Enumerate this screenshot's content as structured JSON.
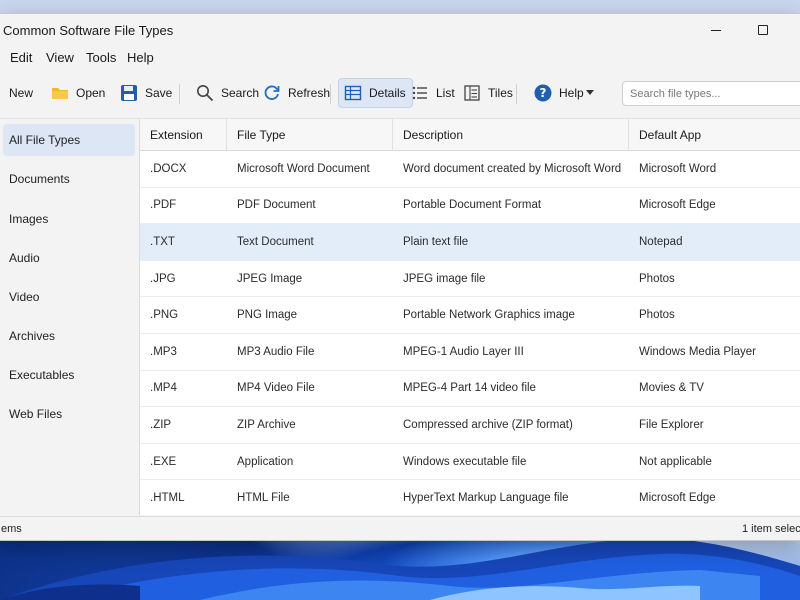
{
  "window": {
    "title": "Common Software File Types"
  },
  "menu": [
    "Edit",
    "View",
    "Tools",
    "Help"
  ],
  "toolbar": {
    "new_label": "New",
    "open_label": "Open",
    "save_label": "Save",
    "search_label": "Search",
    "refresh_label": "Refresh",
    "details_label": "Details",
    "list_label": "List",
    "tiles_label": "Tiles",
    "help_label": "Help",
    "search_placeholder": "Search file types..."
  },
  "sidebar": {
    "items": [
      "All File Types",
      "Documents",
      "Images",
      "Audio",
      "Video",
      "Archives",
      "Executables",
      "Web Files"
    ],
    "selected": "All File Types"
  },
  "table": {
    "columns": [
      "Extension",
      "File Type",
      "Description",
      "Default App"
    ],
    "rows": [
      [
        ".DOCX",
        "Microsoft Word Document",
        "Word document created by Microsoft Word",
        "Microsoft Word"
      ],
      [
        ".PDF",
        "PDF Document",
        "Portable Document Format",
        "Microsoft Edge"
      ],
      [
        ".TXT",
        "Text Document",
        "Plain text file",
        "Notepad"
      ],
      [
        ".JPG",
        "JPEG Image",
        "JPEG image file",
        "Photos"
      ],
      [
        ".PNG",
        "PNG Image",
        "Portable Network Graphics image",
        "Photos"
      ],
      [
        ".MP3",
        "MP3 Audio File",
        "MPEG-1 Audio Layer III",
        "Windows Media Player"
      ],
      [
        ".MP4",
        "MP4 Video File",
        "MPEG-4 Part 14 video file",
        "Movies & TV"
      ],
      [
        ".ZIP",
        "ZIP Archive",
        "Compressed archive (ZIP format)",
        "File Explorer"
      ],
      [
        ".EXE",
        "Application",
        "Windows executable file",
        "Not applicable"
      ],
      [
        ".HTML",
        "HTML File",
        "HyperText Markup Language file",
        "Microsoft Edge"
      ]
    ],
    "selected_row": ".TXT"
  },
  "status": {
    "left": "ems",
    "right": "1 item selec"
  },
  "colors": {
    "accent": "#0f6cbd",
    "selected_bg": "#e3edf9",
    "sidebar_selected": "#dde6f4"
  }
}
